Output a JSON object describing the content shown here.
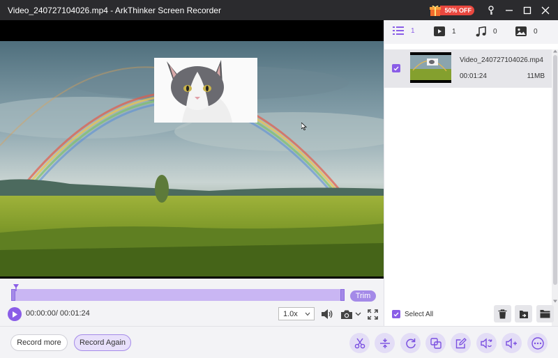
{
  "window": {
    "title": "Video_240727104026.mp4  -  ArkThinker Screen Recorder",
    "promo_label": "50% OFF"
  },
  "icons": [
    "gift-icon",
    "key-icon",
    "minimize-icon",
    "maximize-icon",
    "close-icon",
    "list-icon",
    "video-icon",
    "music-icon",
    "image-icon",
    "play-icon",
    "volume-icon",
    "camera-icon",
    "fullscreen-icon",
    "scissors-icon",
    "compress-icon",
    "rotate-icon",
    "merge-icon",
    "edit-icon",
    "audio-convert-icon",
    "volume-boost-icon",
    "more-icon",
    "trash-icon",
    "export-icon",
    "folder-icon"
  ],
  "colors": {
    "accent": "#8a5de7",
    "accent_light": "#c9b6f3",
    "titlebar": "#2b2b2e",
    "promo": "#e9483f"
  },
  "tabs": [
    {
      "icon": "list-icon",
      "count": "1"
    },
    {
      "icon": "video-icon",
      "count": "1"
    },
    {
      "icon": "music-icon",
      "count": "0"
    },
    {
      "icon": "image-icon",
      "count": "0"
    }
  ],
  "file": {
    "name": "Video_240727104026.mp4",
    "duration": "00:01:24",
    "size": "11MB"
  },
  "select_all_label": "Select All",
  "player": {
    "time": "00:00:00/ 00:01:24",
    "speed": "1.0x",
    "trim_label": "Trim"
  },
  "buttons": {
    "record_more": "Record more",
    "record_again": "Record Again"
  }
}
